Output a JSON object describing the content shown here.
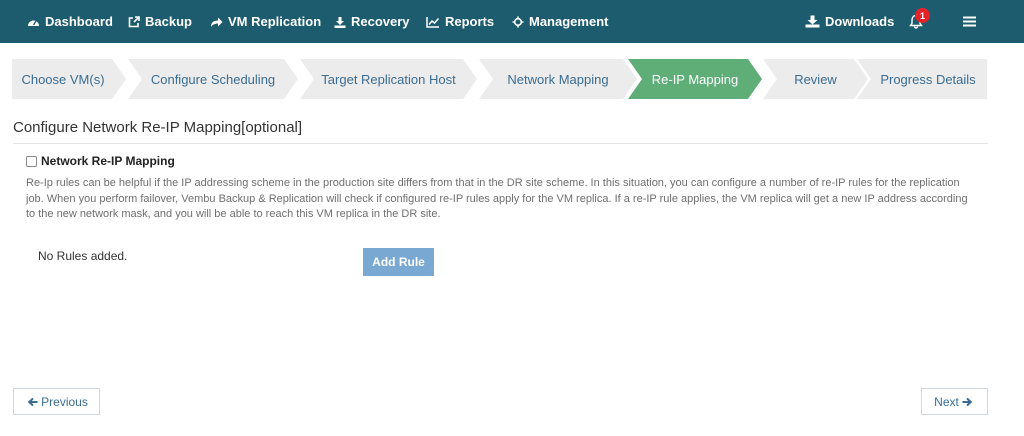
{
  "navbar": {
    "items": [
      {
        "label": "Dashboard",
        "icon": "dashboard-icon"
      },
      {
        "label": "Backup",
        "icon": "external-link-icon"
      },
      {
        "label": "VM Replication",
        "icon": "share-arrow-icon"
      },
      {
        "label": "Recovery",
        "icon": "download-tray-icon"
      },
      {
        "label": "Reports",
        "icon": "line-chart-icon"
      },
      {
        "label": "Management",
        "icon": "crosshair-icon"
      }
    ],
    "downloads_label": "Downloads",
    "notification_count": "1",
    "bg_color": "#1d5c6e"
  },
  "wizard": {
    "steps": [
      {
        "label": "Choose VM(s)",
        "active": false
      },
      {
        "label": "Configure Scheduling",
        "active": false
      },
      {
        "label": "Target Replication Host",
        "active": false
      },
      {
        "label": "Network Mapping",
        "active": false
      },
      {
        "label": "Re-IP Mapping",
        "active": true
      },
      {
        "label": "Review",
        "active": false
      },
      {
        "label": "Progress Details",
        "active": false
      }
    ],
    "active_color": "#5fae78",
    "inactive_color": "#ececec"
  },
  "section": {
    "title": "Configure Network Re-IP Mapping[optional]",
    "checkbox_label": "Network Re-IP Mapping",
    "checkbox_checked": false,
    "description": "Re-Ip rules can be helpful if the IP addressing scheme in the production site differs from that in the DR site scheme. In this situation, you can configure a number of re-IP rules for the replication job. When you perform failover, Vembu Backup & Replication will check if configured re-IP rules apply for the VM replica. If a re-IP rule applies, the VM replica will get a new IP address according to the new network mask, and you will be able to reach this VM replica in the DR site.",
    "no_rules_text": "No Rules added.",
    "add_rule_label": "Add Rule"
  },
  "footer": {
    "previous_label": "Previous",
    "next_label": "Next"
  }
}
